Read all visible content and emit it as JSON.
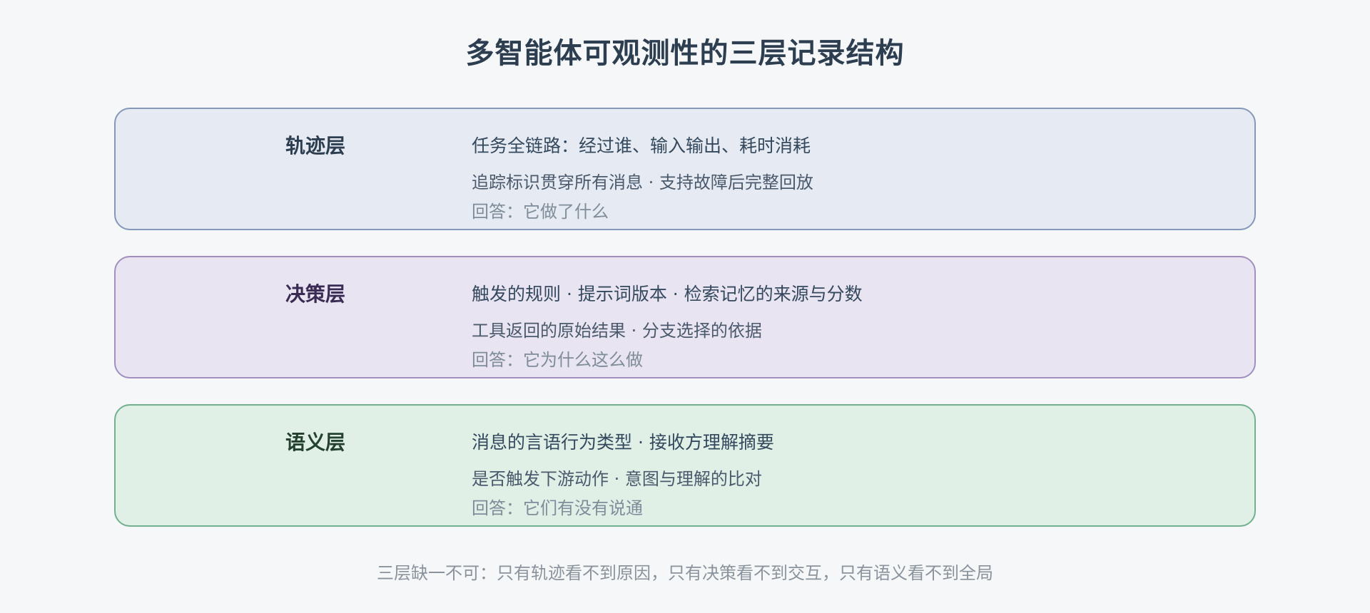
{
  "title": "多智能体可观测性的三层记录结构",
  "layers": [
    {
      "name": "轨迹层",
      "main": "任务全链路：经过谁、输入输出、耗时消耗",
      "sub": "追踪标识贯穿所有消息 · 支持故障后完整回放",
      "answer": "回答：它做了什么",
      "color": "#e6eaf2"
    },
    {
      "name": "决策层",
      "main": "触发的规则 · 提示词版本 · 检索记忆的来源与分数",
      "sub": "工具返回的原始结果 · 分支选择的依据",
      "answer": "回答：它为什么这么做",
      "color": "#e9e4f1"
    },
    {
      "name": "语义层",
      "main": "消息的言语行为类型 · 接收方理解摘要",
      "sub": "是否触发下游动作 · 意图与理解的比对",
      "answer": "回答：它们有没有说通",
      "color": "#e0f0e7"
    }
  ],
  "footer": "三层缺一不可：只有轨迹看不到原因，只有决策看不到交互，只有语义看不到全局"
}
